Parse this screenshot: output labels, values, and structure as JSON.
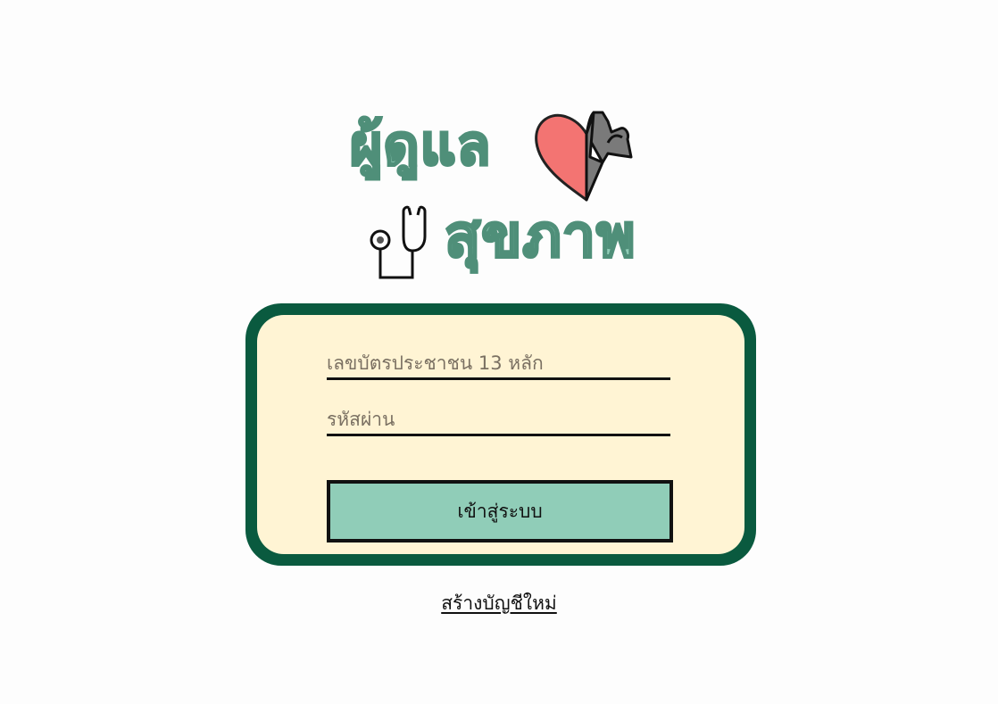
{
  "logo": {
    "line1": "ผู้ดูแล",
    "line2": "สุขภาพ",
    "icons": [
      "heart-muscle-icon",
      "stethoscope-icon"
    ]
  },
  "login": {
    "id_placeholder": "เลขบัตรประชาชน 13 หลัก",
    "id_value": "",
    "password_placeholder": "รหัสผ่าน",
    "password_value": "",
    "submit_label": "เข้าสู่ระบบ"
  },
  "create_account_label": "สร้างบัญชีใหม่",
  "colors": {
    "brand_green": "#0a5a3f",
    "mint": "#90cdb8",
    "card_bg": "#fff4d4",
    "heart_red": "#f37472",
    "heart_gray": "#7a7a7a"
  }
}
